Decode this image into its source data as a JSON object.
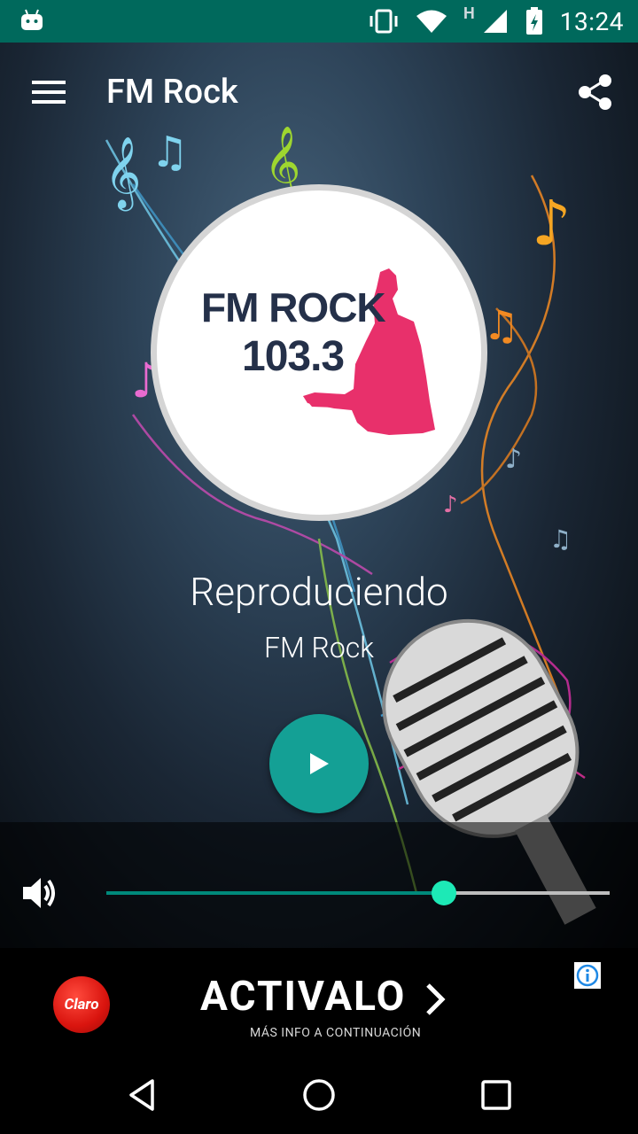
{
  "status_bar": {
    "time": "13:24",
    "network_label": "H"
  },
  "toolbar": {
    "title": "FM Rock"
  },
  "logo": {
    "name": "FM ROCK",
    "frequency": "103.3"
  },
  "player": {
    "status": "Reproduciendo",
    "station": "FM Rock",
    "volume_fraction": 0.67
  },
  "ad": {
    "brand": "Claro",
    "headline": "ACTIVALO",
    "subtitle": "MÁS INFO A CONTINUACIÓN"
  },
  "colors": {
    "accent": "#14a095",
    "status_bar": "#00695c",
    "slider_thumb": "#1de9b6",
    "logo_figure": "#e8306b"
  }
}
